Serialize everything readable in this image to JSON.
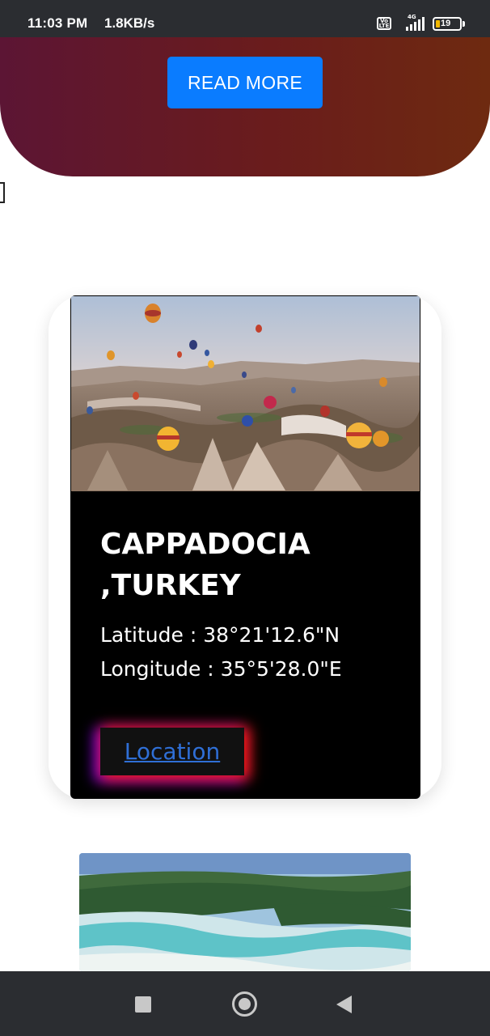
{
  "status_bar": {
    "time": "11:03 PM",
    "network_speed": "1.8KB/s",
    "volte_label": "Vo LTE",
    "network_type": "4G",
    "battery_level": "19"
  },
  "hero": {
    "read_more_label": "READ MORE"
  },
  "destination_card": {
    "title": "CAPPADOCIA ,TURKEY",
    "latitude": "Latitude : 38°21'12.6\"N",
    "longitude": "Longitude : 35°5'28.0\"E",
    "location_label": "Location"
  },
  "colors": {
    "accent_button": "#0a7cff",
    "card_background": "#000000",
    "link": "#2f6fd6"
  },
  "icons": {
    "nav_recent": "square-icon",
    "nav_home": "circle-home-icon",
    "nav_back": "back-triangle-icon"
  }
}
